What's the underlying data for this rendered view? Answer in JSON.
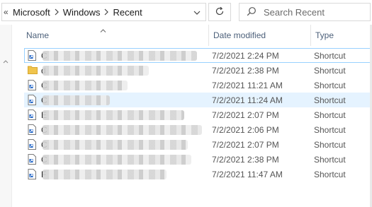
{
  "address_bar": {
    "overflow_chevron": "«",
    "crumbs": [
      "Microsoft",
      "Windows",
      "Recent"
    ]
  },
  "search": {
    "placeholder": "Search Recent"
  },
  "columns": {
    "name": "Name",
    "date": "Date modified",
    "type": "Type"
  },
  "files": [
    {
      "first_letter": "C",
      "icon": "shortcut-icon",
      "date": "7/2/2021 2:24 PM",
      "type": "Shortcut"
    },
    {
      "first_letter": "d",
      "icon": "folder-icon",
      "date": "7/2/2021 2:38 PM",
      "type": "Shortcut"
    },
    {
      "first_letter": "C",
      "icon": "shortcut-icon",
      "date": "7/2/2021 11:21 AM",
      "type": "Shortcut"
    },
    {
      "first_letter": "C",
      "icon": "shortcut-icon",
      "date": "7/2/2021 11:24 AM",
      "type": "Shortcut"
    },
    {
      "first_letter": "E",
      "icon": "shortcut-icon",
      "date": "7/2/2021 2:07 PM",
      "type": "Shortcut"
    },
    {
      "first_letter": "C",
      "icon": "shortcut-icon",
      "date": "7/2/2021 2:06 PM",
      "type": "Shortcut"
    },
    {
      "first_letter": "C",
      "icon": "shortcut-icon",
      "date": "7/2/2021 2:07 PM",
      "type": "Shortcut"
    },
    {
      "first_letter": "C",
      "icon": "shortcut-icon",
      "date": "7/2/2021 2:38 PM",
      "type": "Shortcut"
    },
    {
      "first_letter": "F",
      "icon": "shortcut-icon",
      "date": "7/2/2021 11:47 AM",
      "type": "Shortcut"
    }
  ],
  "colors": {
    "header_text": "#4c607a",
    "selected_row": "#e5f3ff",
    "focus_outline": "#99d1ff",
    "folder": "#f0c44c"
  }
}
